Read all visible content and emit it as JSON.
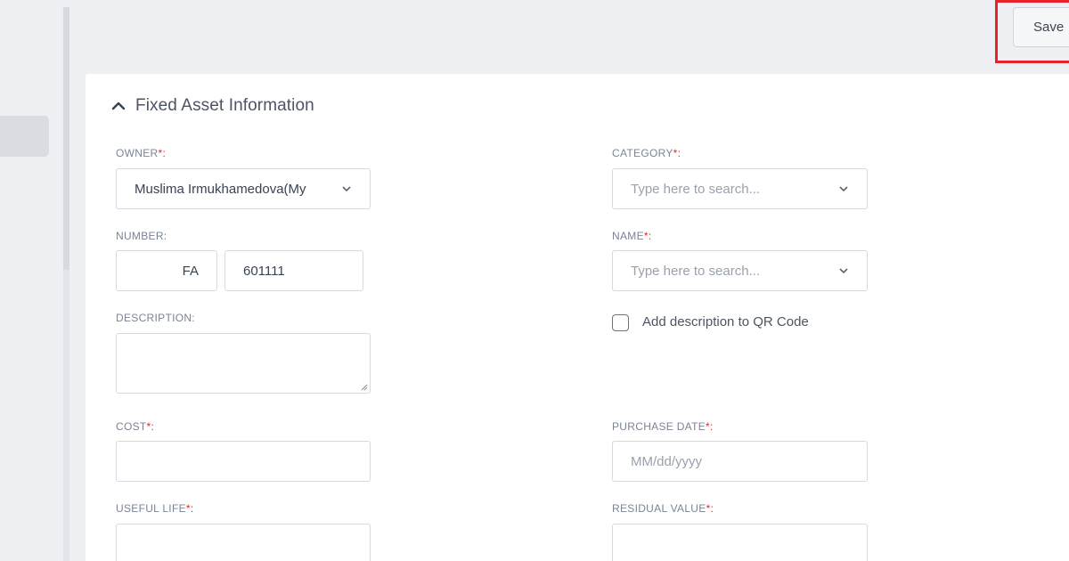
{
  "toolbar": {
    "save_label": "Save"
  },
  "section": {
    "title": "Fixed Asset Information"
  },
  "form": {
    "owner": {
      "label": "OWNER",
      "required_mark": "*:",
      "value": "Muslima Irmukhamedova(My"
    },
    "category": {
      "label": "CATEGORY",
      "required_mark": "*:",
      "placeholder": "Type here to search..."
    },
    "number": {
      "label": "NUMBER:",
      "prefix": "FA",
      "value": "601111"
    },
    "name": {
      "label": "NAME",
      "required_mark": "*:",
      "placeholder": "Type here to search..."
    },
    "description": {
      "label": "DESCRIPTION:"
    },
    "qr": {
      "label": "Add description to QR Code"
    },
    "cost": {
      "label": "COST",
      "required_mark": "*:"
    },
    "purchase_date": {
      "label": "PURCHASE DATE",
      "required_mark": "*:",
      "placeholder": "MM/dd/yyyy"
    },
    "useful_life": {
      "label": "USEFUL LIFE",
      "required_mark": "*:"
    },
    "residual_value": {
      "label": "RESIDUAL VALUE",
      "required_mark": "*:"
    }
  },
  "colors": {
    "highlight": "#e8222b",
    "required": "#d92b2b",
    "background": "#eef0f4"
  }
}
